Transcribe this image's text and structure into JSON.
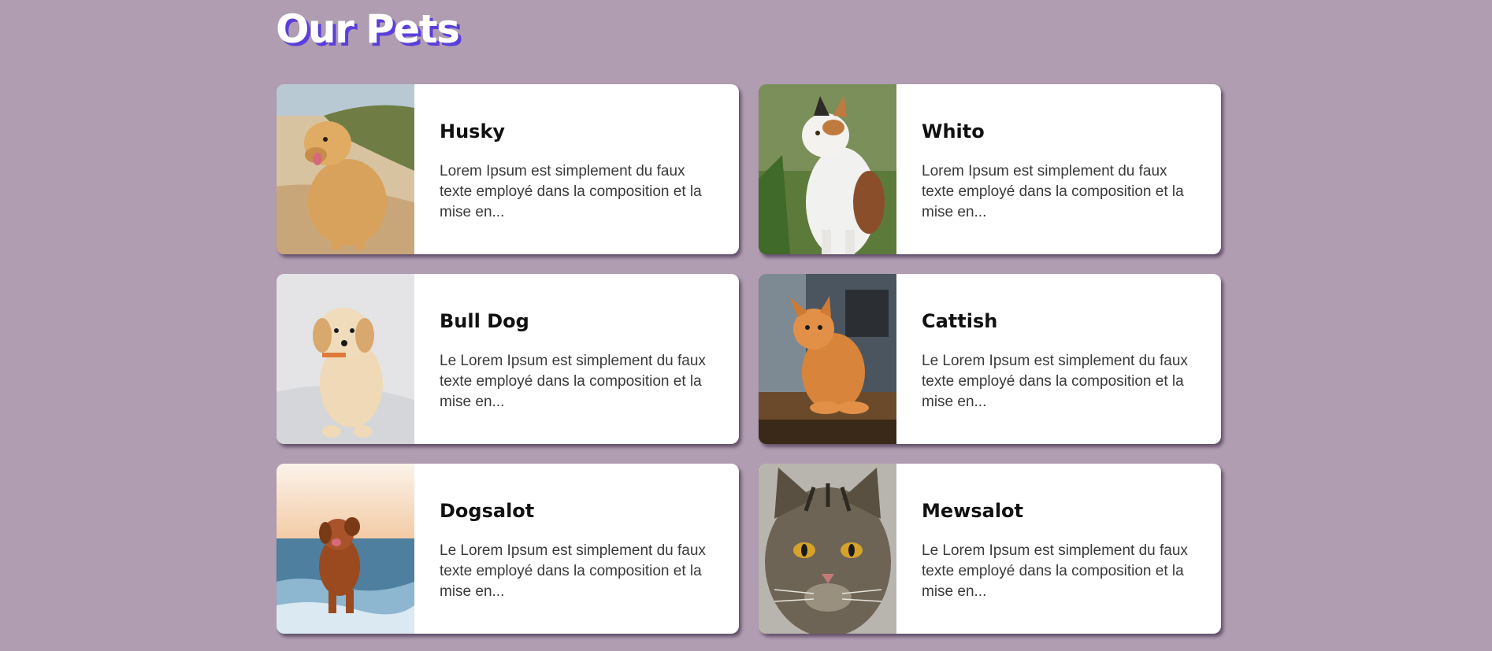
{
  "page": {
    "title": "Our Pets",
    "background": "#b09db2",
    "title_shadow_color": "#5a3fd9"
  },
  "pets": [
    {
      "name": "Husky",
      "description": "Lorem Ipsum est simplement du faux texte employé dans la composition et la mise en...",
      "photo": "golden-retriever-on-beach-photo"
    },
    {
      "name": "Whito",
      "description": "Lorem Ipsum est simplement du faux texte employé dans la composition et la mise en...",
      "photo": "calico-cat-in-grass-photo"
    },
    {
      "name": "Bull Dog",
      "description": "Le Lorem Ipsum est simplement du faux texte employé dans la composition et la mise en...",
      "photo": "fluffy-puppy-on-sheet-photo"
    },
    {
      "name": "Cattish",
      "description": "Le Lorem Ipsum est simplement du faux texte employé dans la composition et la mise en...",
      "photo": "orange-tabby-cat-on-table-photo"
    },
    {
      "name": "Dogsalot",
      "description": "Le Lorem Ipsum est simplement du faux texte employé dans la composition et la mise en...",
      "photo": "dog-running-in-waves-photo"
    },
    {
      "name": "Mewsalot",
      "description": "Le Lorem Ipsum est simplement du faux texte employé dans la composition et la mise en...",
      "photo": "grumpy-tabby-cat-closeup-photo"
    }
  ]
}
